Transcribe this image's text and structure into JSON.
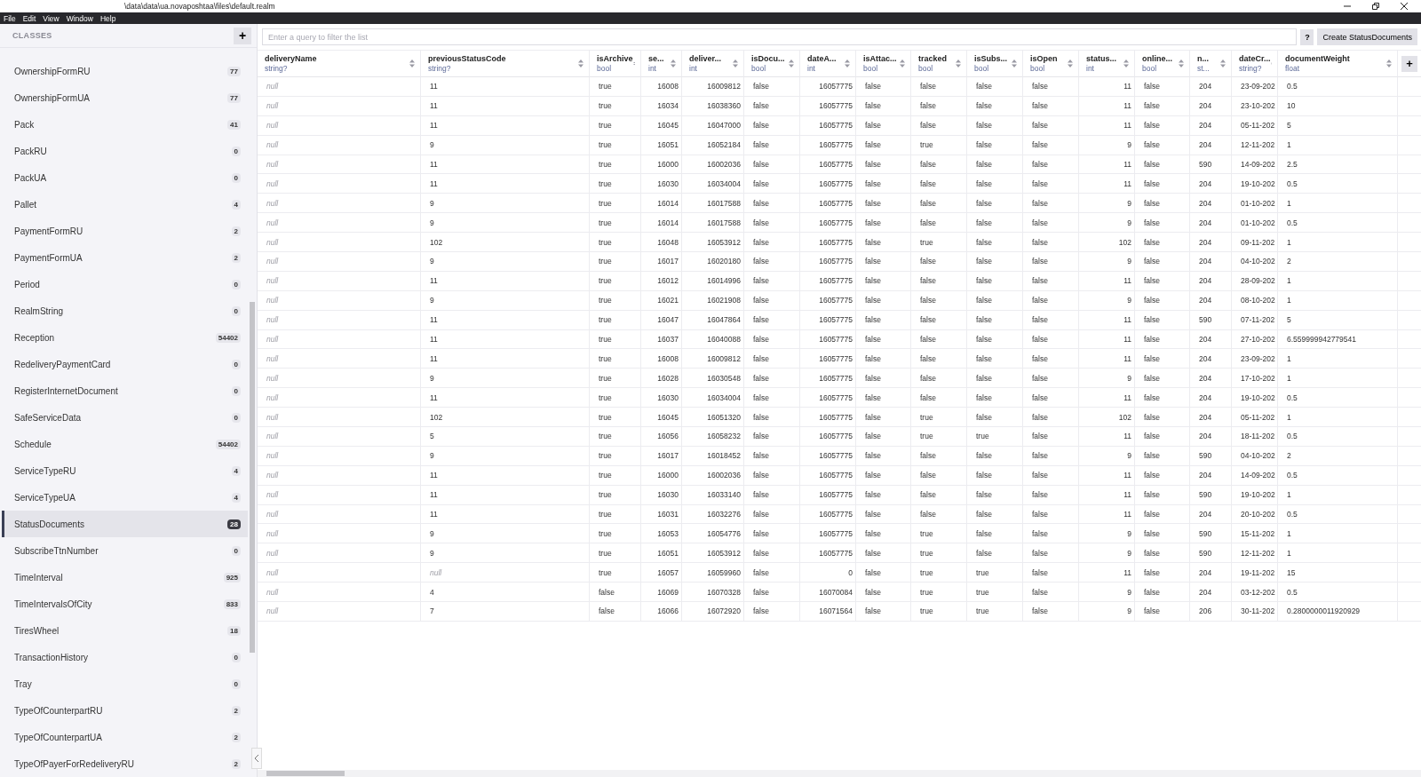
{
  "window": {
    "title": "\\data\\data\\ua.novaposhtaa\\files\\default.realm"
  },
  "menu": [
    "File",
    "Edit",
    "View",
    "Window",
    "Help"
  ],
  "sidebar": {
    "title": "CLASSES",
    "add_button": "+",
    "items": [
      {
        "name": "OwnershipFormRU",
        "count": "77",
        "selected": false
      },
      {
        "name": "OwnershipFormUA",
        "count": "77",
        "selected": false
      },
      {
        "name": "Pack",
        "count": "41",
        "selected": false
      },
      {
        "name": "PackRU",
        "count": "0",
        "selected": false
      },
      {
        "name": "PackUA",
        "count": "0",
        "selected": false
      },
      {
        "name": "Pallet",
        "count": "4",
        "selected": false
      },
      {
        "name": "PaymentFormRU",
        "count": "2",
        "selected": false
      },
      {
        "name": "PaymentFormUA",
        "count": "2",
        "selected": false
      },
      {
        "name": "Period",
        "count": "0",
        "selected": false
      },
      {
        "name": "RealmString",
        "count": "0",
        "selected": false
      },
      {
        "name": "Reception",
        "count": "54402",
        "selected": false
      },
      {
        "name": "RedeliveryPaymentCard",
        "count": "0",
        "selected": false
      },
      {
        "name": "RegisterInternetDocument",
        "count": "0",
        "selected": false
      },
      {
        "name": "SafeServiceData",
        "count": "0",
        "selected": false
      },
      {
        "name": "Schedule",
        "count": "54402",
        "selected": false
      },
      {
        "name": "ServiceTypeRU",
        "count": "4",
        "selected": false
      },
      {
        "name": "ServiceTypeUA",
        "count": "4",
        "selected": false
      },
      {
        "name": "StatusDocuments",
        "count": "28",
        "selected": true
      },
      {
        "name": "SubscribeTtnNumber",
        "count": "0",
        "selected": false
      },
      {
        "name": "TimeInterval",
        "count": "925",
        "selected": false
      },
      {
        "name": "TimeIntervalsOfCity",
        "count": "833",
        "selected": false
      },
      {
        "name": "TiresWheel",
        "count": "18",
        "selected": false
      },
      {
        "name": "TransactionHistory",
        "count": "0",
        "selected": false
      },
      {
        "name": "Tray",
        "count": "0",
        "selected": false
      },
      {
        "name": "TypeOfCounterpartRU",
        "count": "2",
        "selected": false
      },
      {
        "name": "TypeOfCounterpartUA",
        "count": "2",
        "selected": false
      },
      {
        "name": "TypeOfPayerForRedeliveryRU",
        "count": "2",
        "selected": false
      }
    ]
  },
  "toolbar": {
    "search": {
      "placeholder": "Enter a query to filter the list"
    },
    "help_button": "?",
    "create_button": "Create StatusDocuments"
  },
  "table": {
    "add_column_button": "+",
    "columns": [
      {
        "name": "deliveryName",
        "type": "string?",
        "kind": "text"
      },
      {
        "name": "previousStatusCode",
        "type": "string?",
        "kind": "text"
      },
      {
        "name": "isArchive",
        "type": "bool",
        "kind": "text"
      },
      {
        "name": "se...",
        "type": "int",
        "kind": "number"
      },
      {
        "name": "deliver...",
        "type": "int",
        "kind": "number"
      },
      {
        "name": "isDocu...",
        "type": "bool",
        "kind": "text"
      },
      {
        "name": "dateA...",
        "type": "int",
        "kind": "number"
      },
      {
        "name": "isAttac...",
        "type": "bool",
        "kind": "text"
      },
      {
        "name": "tracked",
        "type": "bool",
        "kind": "text"
      },
      {
        "name": "isSubs...",
        "type": "bool",
        "kind": "text"
      },
      {
        "name": "isOpen",
        "type": "bool",
        "kind": "text"
      },
      {
        "name": "status...",
        "type": "int",
        "kind": "number"
      },
      {
        "name": "online...",
        "type": "bool",
        "kind": "text"
      },
      {
        "name": "n...",
        "type": "st...",
        "kind": "text"
      },
      {
        "name": "dateCr...",
        "type": "string?",
        "kind": "text"
      },
      {
        "name": "documentWeight",
        "type": "float",
        "kind": "text"
      }
    ],
    "rows": [
      [
        {
          "text": "null",
          "is_null": true
        },
        "11",
        "true",
        "16008",
        "16009812",
        "false",
        "16057775",
        "false",
        "false",
        "false",
        "false",
        "11",
        "false",
        "204",
        "23-09-202",
        "0.5"
      ],
      [
        {
          "text": "null",
          "is_null": true
        },
        "11",
        "true",
        "16034",
        "16038360",
        "false",
        "16057775",
        "false",
        "false",
        "false",
        "false",
        "11",
        "false",
        "204",
        "23-10-202",
        "10"
      ],
      [
        {
          "text": "null",
          "is_null": true
        },
        "11",
        "true",
        "16045",
        "16047000",
        "false",
        "16057775",
        "false",
        "false",
        "false",
        "false",
        "11",
        "false",
        "204",
        "05-11-202",
        "5"
      ],
      [
        {
          "text": "null",
          "is_null": true
        },
        "9",
        "true",
        "16051",
        "16052184",
        "false",
        "16057775",
        "false",
        "true",
        "false",
        "false",
        "9",
        "false",
        "204",
        "12-11-202",
        "1"
      ],
      [
        {
          "text": "null",
          "is_null": true
        },
        "11",
        "true",
        "16000",
        "16002036",
        "false",
        "16057775",
        "false",
        "false",
        "false",
        "false",
        "11",
        "false",
        "590",
        "14-09-202",
        "2.5"
      ],
      [
        {
          "text": "null",
          "is_null": true
        },
        "11",
        "true",
        "16030",
        "16034004",
        "false",
        "16057775",
        "false",
        "false",
        "false",
        "false",
        "11",
        "false",
        "204",
        "19-10-202",
        "0.5"
      ],
      [
        {
          "text": "null",
          "is_null": true
        },
        "9",
        "true",
        "16014",
        "16017588",
        "false",
        "16057775",
        "false",
        "false",
        "false",
        "false",
        "9",
        "false",
        "204",
        "01-10-202",
        "1"
      ],
      [
        {
          "text": "null",
          "is_null": true
        },
        "9",
        "true",
        "16014",
        "16017588",
        "false",
        "16057775",
        "false",
        "false",
        "false",
        "false",
        "9",
        "false",
        "204",
        "01-10-202",
        "0.5"
      ],
      [
        {
          "text": "null",
          "is_null": true
        },
        "102",
        "true",
        "16048",
        "16053912",
        "false",
        "16057775",
        "false",
        "true",
        "false",
        "false",
        "102",
        "false",
        "204",
        "09-11-202",
        "1"
      ],
      [
        {
          "text": "null",
          "is_null": true
        },
        "9",
        "true",
        "16017",
        "16020180",
        "false",
        "16057775",
        "false",
        "false",
        "false",
        "false",
        "9",
        "false",
        "204",
        "04-10-202",
        "2"
      ],
      [
        {
          "text": "null",
          "is_null": true
        },
        "11",
        "true",
        "16012",
        "16014996",
        "false",
        "16057775",
        "false",
        "false",
        "false",
        "false",
        "11",
        "false",
        "204",
        "28-09-202",
        "1"
      ],
      [
        {
          "text": "null",
          "is_null": true
        },
        "9",
        "true",
        "16021",
        "16021908",
        "false",
        "16057775",
        "false",
        "false",
        "false",
        "false",
        "9",
        "false",
        "204",
        "08-10-202",
        "1"
      ],
      [
        {
          "text": "null",
          "is_null": true
        },
        "11",
        "true",
        "16047",
        "16047864",
        "false",
        "16057775",
        "false",
        "false",
        "false",
        "false",
        "11",
        "false",
        "590",
        "07-11-202",
        "5"
      ],
      [
        {
          "text": "null",
          "is_null": true
        },
        "11",
        "true",
        "16037",
        "16040088",
        "false",
        "16057775",
        "false",
        "false",
        "false",
        "false",
        "11",
        "false",
        "204",
        "27-10-202",
        "6.559999942779541"
      ],
      [
        {
          "text": "null",
          "is_null": true
        },
        "11",
        "true",
        "16008",
        "16009812",
        "false",
        "16057775",
        "false",
        "false",
        "false",
        "false",
        "11",
        "false",
        "204",
        "23-09-202",
        "1"
      ],
      [
        {
          "text": "null",
          "is_null": true
        },
        "9",
        "true",
        "16028",
        "16030548",
        "false",
        "16057775",
        "false",
        "false",
        "false",
        "false",
        "9",
        "false",
        "204",
        "17-10-202",
        "1"
      ],
      [
        {
          "text": "null",
          "is_null": true
        },
        "11",
        "true",
        "16030",
        "16034004",
        "false",
        "16057775",
        "false",
        "false",
        "false",
        "false",
        "11",
        "false",
        "204",
        "19-10-202",
        "0.5"
      ],
      [
        {
          "text": "null",
          "is_null": true
        },
        "102",
        "true",
        "16045",
        "16051320",
        "false",
        "16057775",
        "false",
        "true",
        "false",
        "false",
        "102",
        "false",
        "204",
        "05-11-202",
        "1"
      ],
      [
        {
          "text": "null",
          "is_null": true
        },
        "5",
        "true",
        "16056",
        "16058232",
        "false",
        "16057775",
        "false",
        "true",
        "true",
        "false",
        "11",
        "false",
        "204",
        "18-11-202",
        "0.5"
      ],
      [
        {
          "text": "null",
          "is_null": true
        },
        "9",
        "true",
        "16017",
        "16018452",
        "false",
        "16057775",
        "false",
        "false",
        "false",
        "false",
        "9",
        "false",
        "590",
        "04-10-202",
        "2"
      ],
      [
        {
          "text": "null",
          "is_null": true
        },
        "11",
        "true",
        "16000",
        "16002036",
        "false",
        "16057775",
        "false",
        "false",
        "false",
        "false",
        "11",
        "false",
        "204",
        "14-09-202",
        "0.5"
      ],
      [
        {
          "text": "null",
          "is_null": true
        },
        "11",
        "true",
        "16030",
        "16033140",
        "false",
        "16057775",
        "false",
        "false",
        "false",
        "false",
        "11",
        "false",
        "590",
        "19-10-202",
        "1"
      ],
      [
        {
          "text": "null",
          "is_null": true
        },
        "11",
        "true",
        "16031",
        "16032276",
        "false",
        "16057775",
        "false",
        "false",
        "false",
        "false",
        "11",
        "false",
        "204",
        "20-10-202",
        "0.5"
      ],
      [
        {
          "text": "null",
          "is_null": true
        },
        "9",
        "true",
        "16053",
        "16054776",
        "false",
        "16057775",
        "false",
        "true",
        "false",
        "false",
        "9",
        "false",
        "590",
        "15-11-202",
        "1"
      ],
      [
        {
          "text": "null",
          "is_null": true
        },
        "9",
        "true",
        "16051",
        "16053912",
        "false",
        "16057775",
        "false",
        "true",
        "false",
        "false",
        "9",
        "false",
        "590",
        "12-11-202",
        "1"
      ],
      [
        {
          "text": "null",
          "is_null": true
        },
        {
          "text": "null",
          "is_null": true
        },
        "true",
        "16057",
        "16059960",
        "false",
        "0",
        "false",
        "true",
        "true",
        "false",
        "11",
        "false",
        "204",
        "19-11-202",
        "15"
      ],
      [
        {
          "text": "null",
          "is_null": true
        },
        "4",
        "false",
        "16069",
        "16070328",
        "false",
        "16070084",
        "false",
        "true",
        "true",
        "false",
        "9",
        "false",
        "204",
        "03-12-202",
        "0.5"
      ],
      [
        {
          "text": "null",
          "is_null": true
        },
        "7",
        "false",
        "16066",
        "16072920",
        "false",
        "16071564",
        "false",
        "true",
        "true",
        "false",
        "9",
        "false",
        "206",
        "30-11-202",
        "0.2800000011920929"
      ]
    ]
  }
}
